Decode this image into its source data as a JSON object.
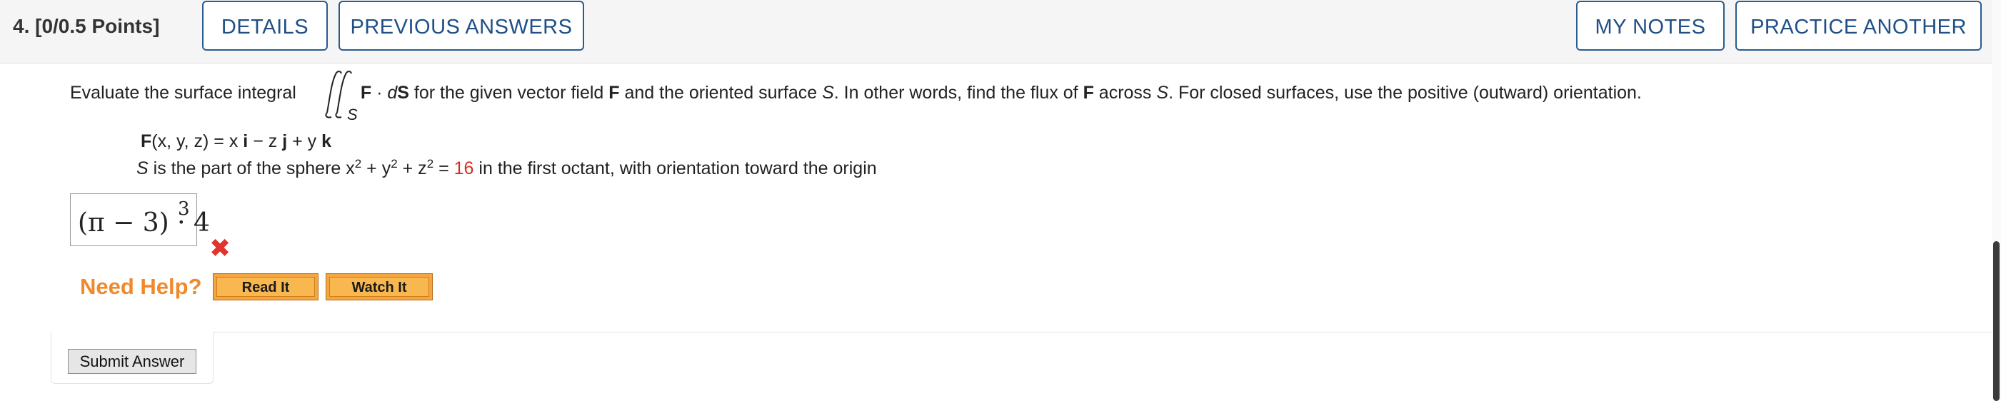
{
  "header": {
    "question_label": "4.  [0/0.5 Points]",
    "buttons": {
      "details": "DETAILS",
      "previous_answers": "PREVIOUS ANSWERS",
      "my_notes": "MY NOTES",
      "practice_another": "PRACTICE ANOTHER"
    }
  },
  "question": {
    "prompt_start": "Evaluate the surface integral",
    "integral_subscript": "S",
    "integrand_bold_F": "F",
    "integrand_dot": " · ",
    "integrand_d": "d",
    "integrand_bold_S": "S",
    "prompt_mid_1": "  for the given vector field ",
    "field_F": "F",
    "prompt_mid_2": " and the oriented surface ",
    "surface_S": "S",
    "prompt_mid_3": ". In other words, find the flux of ",
    "field_F2": "F",
    "prompt_mid_4": " across ",
    "surface_S2": "S",
    "prompt_end": ". For closed surfaces, use the positive (outward) orientation.",
    "field_definition": {
      "F": "F",
      "args": "(x, y, z) = x ",
      "i": "i",
      "mid1": " − z ",
      "j": "j",
      "mid2": " + y ",
      "k": "k"
    },
    "surface_definition": {
      "S": "S",
      "text1": " is the part of the sphere  x",
      "sup1": "2",
      "text2": " + y",
      "sup2": "2",
      "text3": " + z",
      "sup3": "2",
      "text4": " = ",
      "value": "16",
      "text5": "  in the first octant, with orientation toward the origin"
    }
  },
  "answer": {
    "entered_value": "(π − 3) · 4",
    "entered_exponent": "3",
    "status": "incorrect",
    "status_color": "#e0342c"
  },
  "help": {
    "label": "Need Help?",
    "read_it": "Read It",
    "watch_it": "Watch It"
  },
  "submit": {
    "label": "Submit Answer"
  },
  "colors": {
    "button_border": "#2a5b8f",
    "button_text": "#1f4f86",
    "help_orange": "#f0892c",
    "highlight_red": "#d62d20"
  }
}
